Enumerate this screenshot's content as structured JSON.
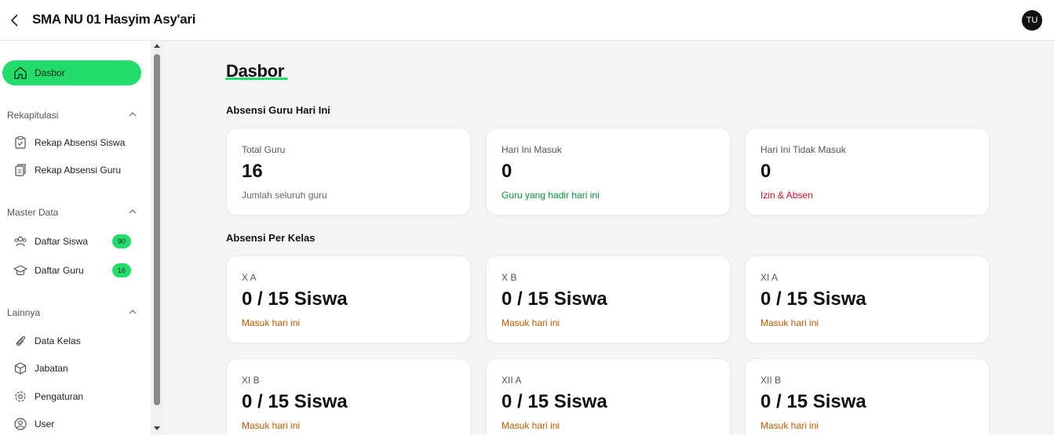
{
  "header": {
    "title": "SMA NU 01 Hasyim Asy'ari",
    "avatar_initials": "TU"
  },
  "sidebar": {
    "active": {
      "label": "Dasbor",
      "icon": "home-icon"
    },
    "sections": [
      {
        "title": "Rekapitulasi",
        "items": [
          {
            "label": "Rekap Absensi Siswa",
            "icon": "clipboard-check-icon"
          },
          {
            "label": "Rekap Absensi Guru",
            "icon": "clipboard-copy-icon"
          }
        ]
      },
      {
        "title": "Master Data",
        "items": [
          {
            "label": "Daftar Siswa",
            "icon": "users-icon",
            "badge": "90"
          },
          {
            "label": "Daftar Guru",
            "icon": "graduation-cap-icon",
            "badge": "16"
          }
        ]
      },
      {
        "title": "Lainnya",
        "items": [
          {
            "label": "Data Kelas",
            "icon": "paperclip-icon"
          },
          {
            "label": "Jabatan",
            "icon": "box-icon"
          },
          {
            "label": "Pengaturan",
            "icon": "gear-icon"
          },
          {
            "label": "User",
            "icon": "user-circle-icon"
          }
        ]
      }
    ]
  },
  "main": {
    "title": "Dasbor",
    "teacher_section": {
      "title": "Absensi Guru Hari Ini",
      "cards": [
        {
          "label": "Total Guru",
          "value": "16",
          "sub": "Jumlah seluruh guru"
        },
        {
          "label": "Hari Ini Masuk",
          "value": "0",
          "sub": "Guru yang hadir hari ini"
        },
        {
          "label": "Hari Ini Tidak Masuk",
          "value": "0",
          "sub": "Izin & Absen"
        }
      ]
    },
    "class_section": {
      "title": "Absensi Per Kelas",
      "cards": [
        {
          "label": "X A",
          "value": "0 / 15 Siswa",
          "sub": "Masuk hari ini"
        },
        {
          "label": "X B",
          "value": "0 / 15 Siswa",
          "sub": "Masuk hari ini"
        },
        {
          "label": "XI A",
          "value": "0 / 15 Siswa",
          "sub": "Masuk hari ini"
        },
        {
          "label": "XI B",
          "value": "0 / 15 Siswa",
          "sub": "Masuk hari ini"
        },
        {
          "label": "XII A",
          "value": "0 / 15 Siswa",
          "sub": "Masuk hari ini"
        },
        {
          "label": "XII B",
          "value": "0 / 15 Siswa",
          "sub": "Masuk hari ini"
        }
      ]
    }
  },
  "colors": {
    "accent": "#22dc6b",
    "present": "#0a8f3a",
    "absent": "#d0102b",
    "class_sub": "#c25a00"
  }
}
